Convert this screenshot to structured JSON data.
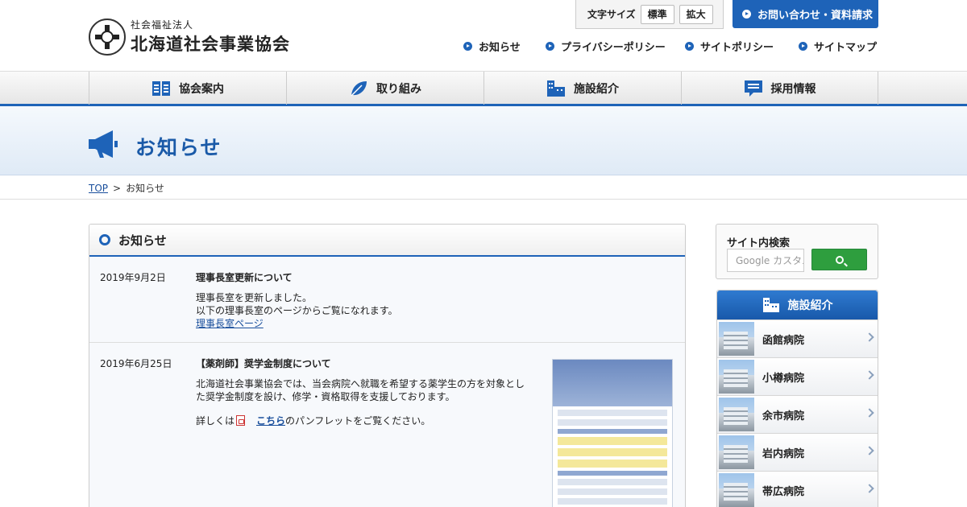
{
  "header": {
    "logo_sub": "社会福祉法人",
    "logo_main": "北海道社会事業協会",
    "fontsize_label": "文字サイズ",
    "fontsize_standard": "標準",
    "fontsize_large": "拡大",
    "contact_label": "お問い合わせ・資料請求",
    "links": [
      "お知らせ",
      "プライバシーポリシー",
      "サイトポリシー",
      "サイトマップ"
    ]
  },
  "gnav": {
    "items": [
      "協会案内",
      "取り組み",
      "施設紹介",
      "採用情報"
    ]
  },
  "page": {
    "title": "お知らせ"
  },
  "breadcrumb": {
    "top": "TOP",
    "separator": ">",
    "current": "お知らせ"
  },
  "main": {
    "heading": "お知らせ",
    "news": [
      {
        "date": "2019年9月2日",
        "title": "理事長室更新について",
        "body1": "理事長室を更新しました。",
        "body2": "以下の理事長室のページからご覧になれます。",
        "link": "理事長室ページ"
      },
      {
        "date": "2019年6月25日",
        "title": "【薬剤師】奨学金制度について",
        "body1": "北海道社会事業協会では、当会病院へ就職を希望する薬学生の方を対象とし",
        "body2": "た奨学金制度を設け、修学・資格取得を支援しております。",
        "detail_prefix": "詳しくは",
        "link": "こちら",
        "detail_suffix": "のパンフレットをご覧ください。"
      }
    ]
  },
  "sidebar": {
    "search_label": "サイト内検索",
    "search_placeholder": "Google カスタム検索",
    "facilities_heading": "施設紹介",
    "facilities": [
      "函館病院",
      "小樽病院",
      "余市病院",
      "岩内病院",
      "帯広病院"
    ]
  },
  "colors": {
    "brand_blue": "#1e63b8",
    "search_green": "#2e9e3e"
  }
}
